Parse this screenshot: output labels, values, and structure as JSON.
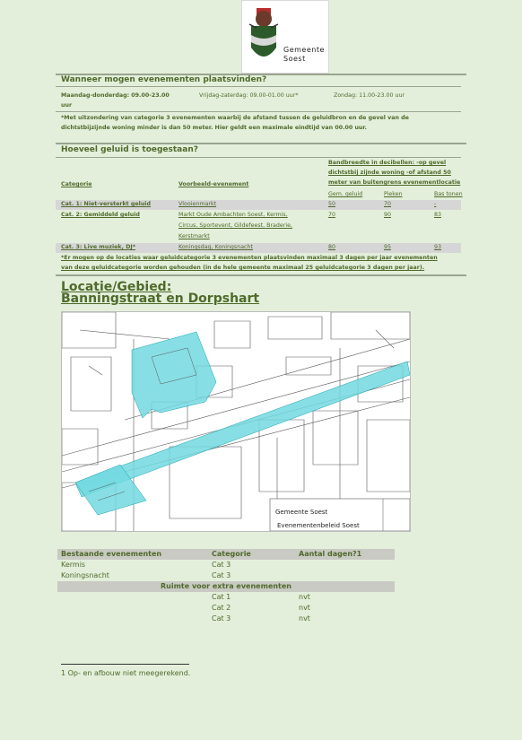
{
  "logo": {
    "line1": "Gemeente",
    "line2": "Soest"
  },
  "when": {
    "title": "Wanneer mogen evenementen plaatsvinden?",
    "weekday_label": "Maandag-donderdag: 09.00-23.00",
    "weekday_suffix": "uur",
    "friday_label": "Vrijdag-zaterdag: 09.00-01.00 uur*",
    "sunday_label": "Zondag: 11.00-23.00 uur",
    "note_line1": "*Met uitzondering van categorie 3 evenementen waarbij de afstand tussen de geluidbron en de gevel van de",
    "note_line2": "dichtstbijzijnde woning minder is dan 50 meter. Hier geldt een maximale eindtijd van 00.00 uur."
  },
  "sound": {
    "title": "Hoeveel geluid is toegestaan?",
    "band_line1": "Bandbreedte in decibellen: -op gevel",
    "band_line2": "dichtstbij zijnde woning -of afstand 50",
    "band_line3": "meter van buitengrens evenementlocatie",
    "col_category": "Categorie",
    "col_example": "Voorbeeld-evenement",
    "col_avg": "Gem. geluid",
    "col_peak": "Pieken",
    "col_bass": "Bas tonen",
    "rows": [
      {
        "cat": "Cat. 1: Niet-versterkt geluid",
        "ex": [
          "Vlooienmarkt"
        ],
        "avg": "50",
        "peak": "70",
        "bass": "-"
      },
      {
        "cat": "Cat. 2: Gemiddeld geluid",
        "ex": [
          "Markt Oude Ambachten Soest, Kermis,",
          "Circus, Sportevent, Gildefeest, Braderie,",
          "Kerstmarkt"
        ],
        "avg": "70",
        "peak": "90",
        "bass": "83"
      },
      {
        "cat": "Cat. 3: Live muziek, DJ*",
        "ex": [
          "Koningsdag, Koningsnacht"
        ],
        "avg": "80",
        "peak": "95",
        "bass": "93"
      }
    ],
    "foot_line1": "*Er mogen op de locaties waar geluidcategorie 3 evenementen plaatsvinden maximaal 3 dagen per jaar evenementen",
    "foot_line2": "van deze geluidcategorie worden gehouden (in de hele gemeente maximaal 25 geluidcategorie 3 dagen per jaar)."
  },
  "location": {
    "title1": "Locatie/Gebied:",
    "title2": "Banningstraat en Dorpshart"
  },
  "map": {
    "brand": "Gemeente Soest",
    "caption": "Evenementenbeleid Soest",
    "highlight_color": "#72d9e0"
  },
  "events": {
    "header": [
      "Bestaande evenementen",
      "Categorie",
      "Aantal dagen?1"
    ],
    "existing": [
      {
        "name": "Kermis",
        "cat": "Cat 3"
      },
      {
        "name": "Koningsnacht",
        "cat": "Cat 3"
      }
    ],
    "space_label": "Ruimte voor extra evenementen",
    "extra": [
      {
        "cat": "Cat 1",
        "days": "nvt"
      },
      {
        "cat": "Cat 2",
        "days": "nvt"
      },
      {
        "cat": "Cat 3",
        "days": "nvt"
      }
    ]
  },
  "footnote": "1 Op- en afbouw niet meegerekend."
}
